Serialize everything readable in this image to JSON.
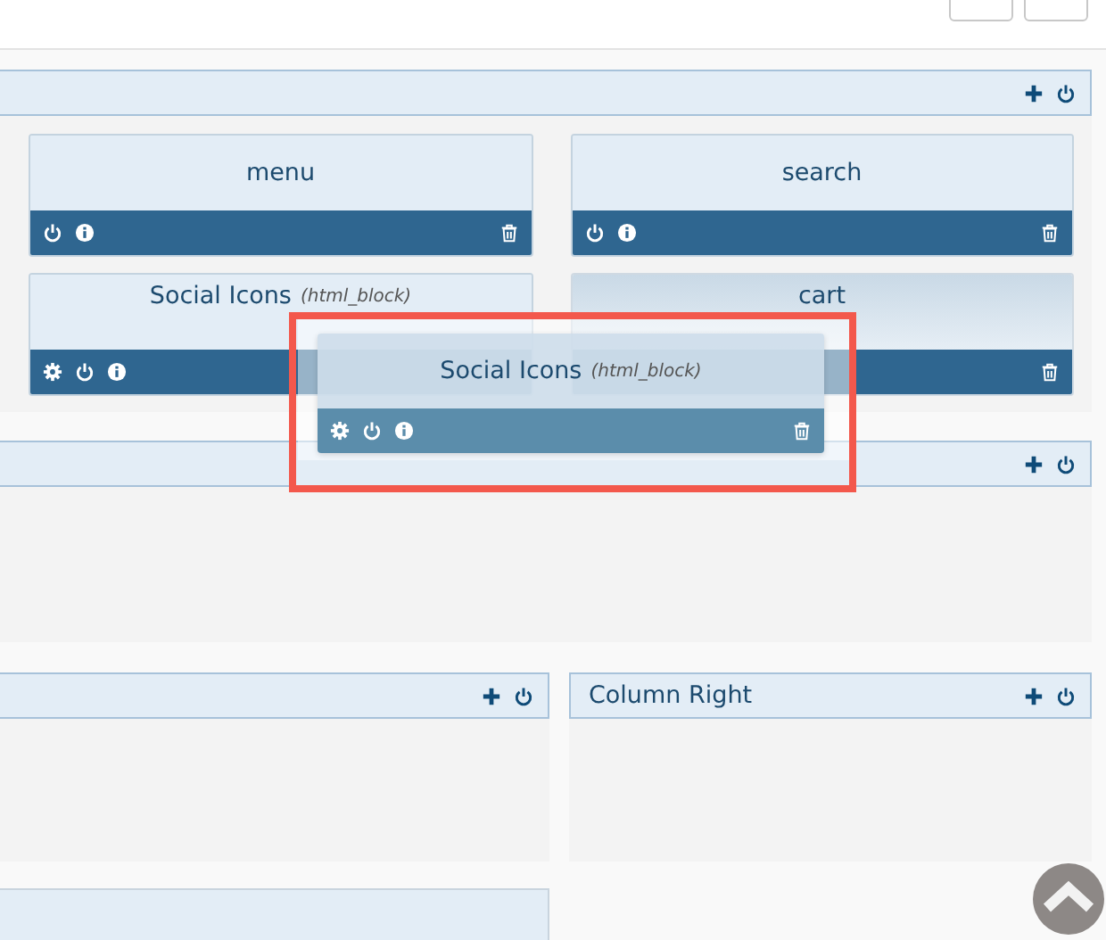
{
  "sections": [
    {
      "kind": "blocks",
      "rows": [
        [
          {
            "title": "menu",
            "settings": false,
            "power": true,
            "info": true,
            "trash": true,
            "highlighted": false
          },
          {
            "title": "search",
            "settings": false,
            "power": true,
            "info": true,
            "trash": true,
            "highlighted": false
          }
        ],
        [
          {
            "title": "Social Icons",
            "type": "(html_block)",
            "settings": true,
            "power": true,
            "info": true,
            "trash": false,
            "highlighted": false
          },
          {
            "title": "cart",
            "settings": false,
            "power": false,
            "info": false,
            "trash": true,
            "highlighted": true
          }
        ]
      ]
    },
    {
      "kind": "empty"
    },
    {
      "kind": "columns",
      "columns": [
        {},
        {
          "title": "Column Right"
        }
      ]
    },
    {
      "kind": "bar"
    }
  ],
  "dragged_block": {
    "title": "Social Icons",
    "type": "(html_block)",
    "settings": true
  }
}
